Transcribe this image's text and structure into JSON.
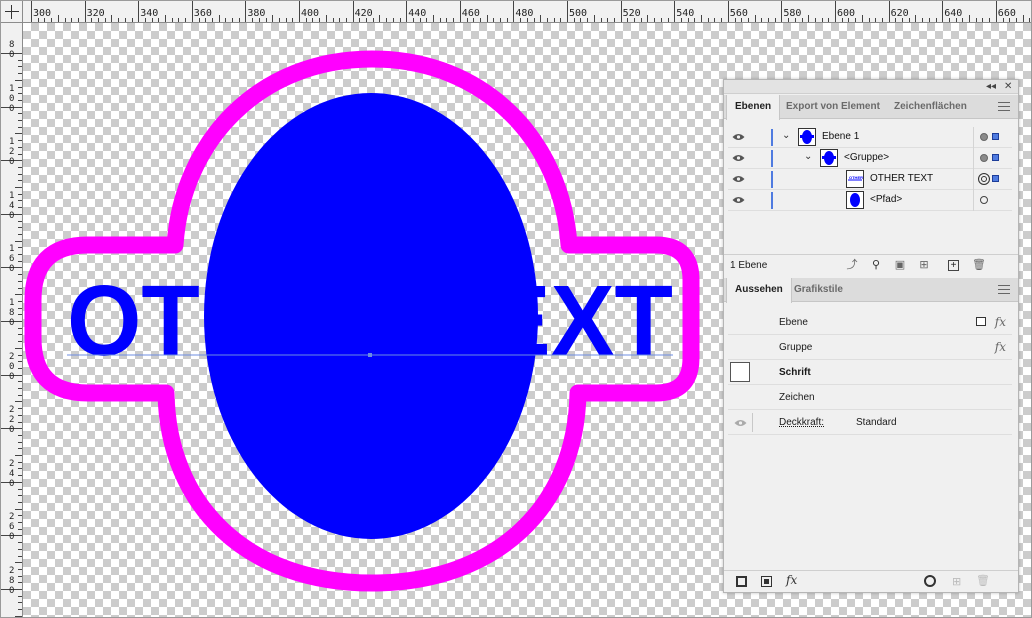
{
  "ruler": {
    "top_labels": [
      "300",
      "320",
      "340",
      "360",
      "380",
      "400",
      "420",
      "440",
      "460",
      "480",
      "500",
      "520",
      "540",
      "560",
      "580",
      "600",
      "620",
      "640",
      "660"
    ],
    "left_labels": [
      [
        "8",
        "0"
      ],
      [
        "1",
        "0",
        "0"
      ],
      [
        "1",
        "2",
        "0"
      ],
      [
        "1",
        "4",
        "0"
      ],
      [
        "1",
        "6",
        "0"
      ],
      [
        "1",
        "8",
        "0"
      ],
      [
        "2",
        "0",
        "0"
      ],
      [
        "2",
        "2",
        "0"
      ],
      [
        "2",
        "4",
        "0"
      ],
      [
        "2",
        "6",
        "0"
      ],
      [
        "2",
        "8",
        "0"
      ]
    ]
  },
  "artwork": {
    "text": "OTHER TEXT",
    "text_color": "#0000ff",
    "ellipse_color": "#0000ff",
    "outline_color": "#ff00ff",
    "gap_color": "#ffffff"
  },
  "panel": {
    "collapse_symbol": "◂◂",
    "close_symbol": "✕",
    "tabs": [
      {
        "label": "Ebenen",
        "active": true
      },
      {
        "label": "Export von Element",
        "active": false
      },
      {
        "label": "Zeichenflächen",
        "active": false
      }
    ],
    "layers": [
      {
        "name": "Ebene 1",
        "indent": 0,
        "expandable": true,
        "icon": "ellipse-text-thumb"
      },
      {
        "name": "<Gruppe>",
        "indent": 1,
        "expandable": true,
        "icon": "ellipse-text-thumb"
      },
      {
        "name": "OTHER TEXT",
        "indent": 2,
        "expandable": false,
        "icon": "text-path-thumb"
      },
      {
        "name": "<Pfad>",
        "indent": 2,
        "expandable": false,
        "icon": "ellipse-thumb"
      }
    ],
    "layer_count": "1 Ebene",
    "appearance_tabs": [
      {
        "label": "Aussehen",
        "active": true
      },
      {
        "label": "Grafikstile",
        "active": false
      }
    ],
    "appearance_rows": {
      "ebene": "Ebene",
      "gruppe": "Gruppe",
      "schrift": "Schrift",
      "zeichen": "Zeichen",
      "deckkraft_label": "Deckkraft:",
      "deckkraft_value": "Standard"
    },
    "fx_symbol": "fx",
    "accent": "#4f7be0"
  }
}
